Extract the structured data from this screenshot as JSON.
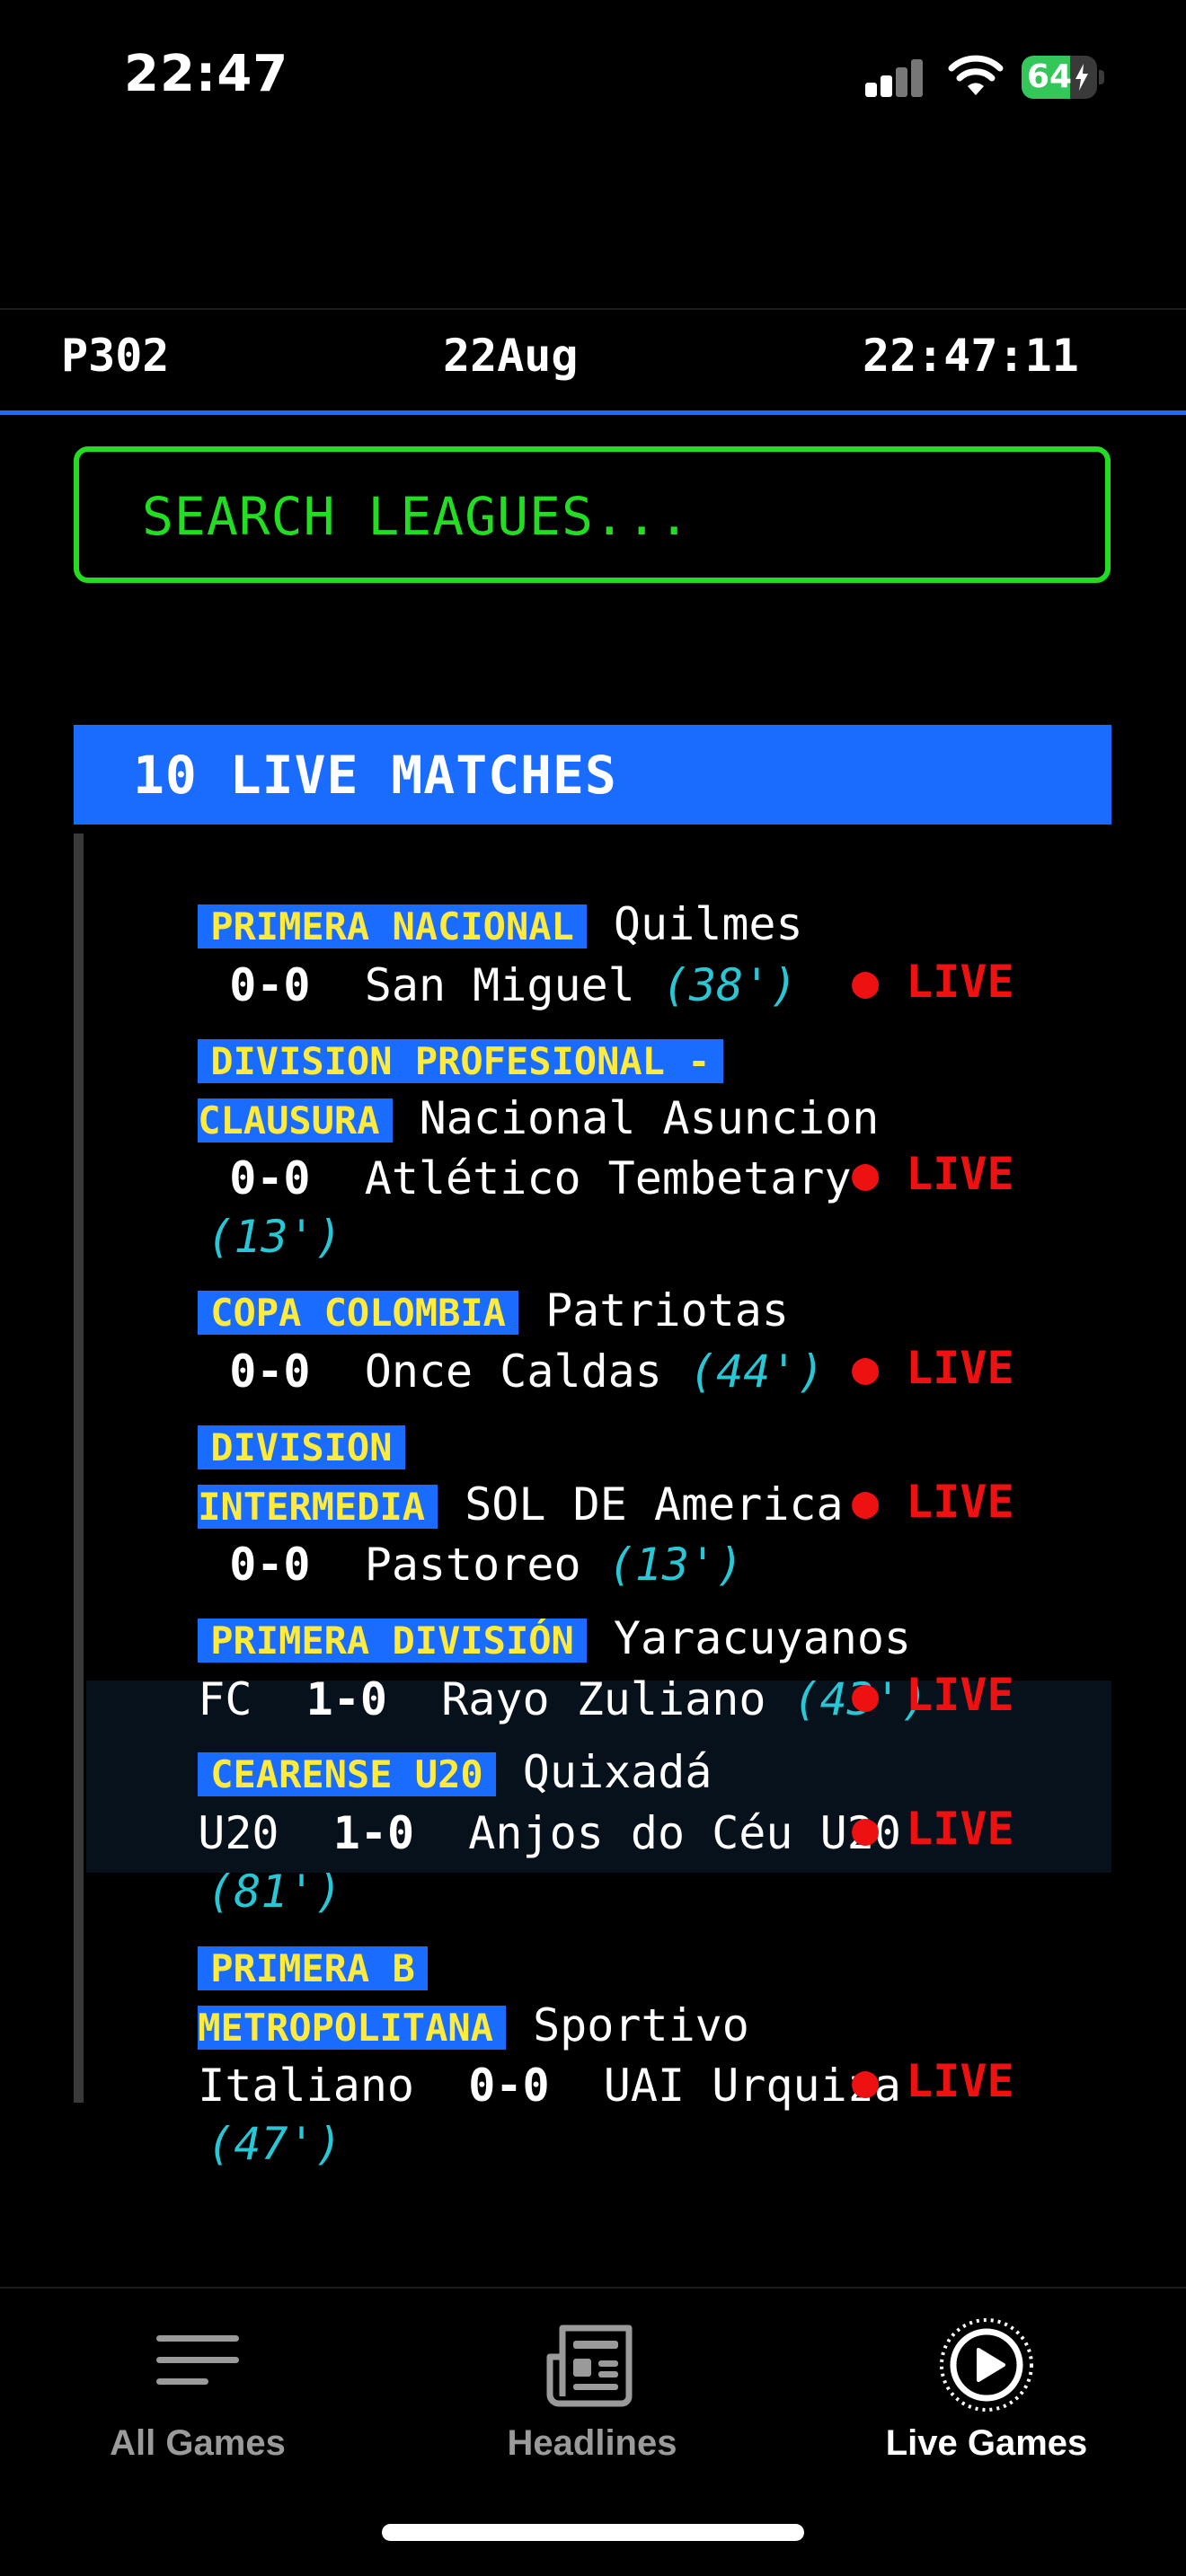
{
  "status_bar": {
    "time": "22:47",
    "battery": "64",
    "battery_level": 0.64
  },
  "header": {
    "page": "P302",
    "date": "22Aug",
    "clock": "22:47:11"
  },
  "search": {
    "placeholder": "SEARCH LEAGUES..."
  },
  "banner": {
    "title": "10 LIVE MATCHES"
  },
  "matches": [
    {
      "league": "PRIMERA NACIONAL",
      "home": "Quilmes",
      "score": "0-0",
      "away": "San Miguel",
      "minute": "(38')",
      "live": "● LIVE"
    },
    {
      "league_line1": "DIVISION PROFESIONAL -",
      "league_line2": "CLAUSURA",
      "home": "Nacional Asuncion",
      "score": "0-0",
      "away": "Atlético Tembetary",
      "minute": "(13')",
      "live": "● LIVE"
    },
    {
      "league": "COPA COLOMBIA",
      "home": "Patriotas",
      "score": "0-0",
      "away": "Once Caldas",
      "minute": "(44')",
      "live": "● LIVE"
    },
    {
      "league_line1": "DIVISION",
      "league_line2": "INTERMEDIA",
      "home": "SOL DE America",
      "score": "0-0",
      "away": "Pastoreo",
      "minute": "(13')",
      "live": "● LIVE"
    },
    {
      "league": "PRIMERA DIVISIÓN",
      "home_line1": "Yaracuyanos",
      "home_line2": "FC",
      "score": "1-0",
      "away": "Rayo Zuliano",
      "minute": "(43')",
      "live": "● LIVE"
    },
    {
      "league": "CEARENSE U20",
      "home_line1": "Quixadá",
      "home_line2": "U20",
      "score": "1-0",
      "away": "Anjos do Céu U20",
      "minute": "(81')",
      "live": "● LIVE"
    },
    {
      "league_line1": "PRIMERA B",
      "league_line2": "METROPOLITANA",
      "home_line1": "Sportivo",
      "home_line2": "Italiano",
      "score": "0-0",
      "away": "UAI Urquiza",
      "minute": "(47')",
      "live": "● LIVE"
    }
  ],
  "tabs": [
    {
      "label": "All Games",
      "icon": "list-icon"
    },
    {
      "label": "Headlines",
      "icon": "newspaper-icon"
    },
    {
      "label": "Live Games",
      "icon": "play-circle-icon"
    }
  ],
  "colors": {
    "accent": "#1a6cff",
    "league_text": "#ffeb3b",
    "search_green": "#22dd22",
    "minute": "#29c7d6",
    "live_red": "#ee1111"
  }
}
